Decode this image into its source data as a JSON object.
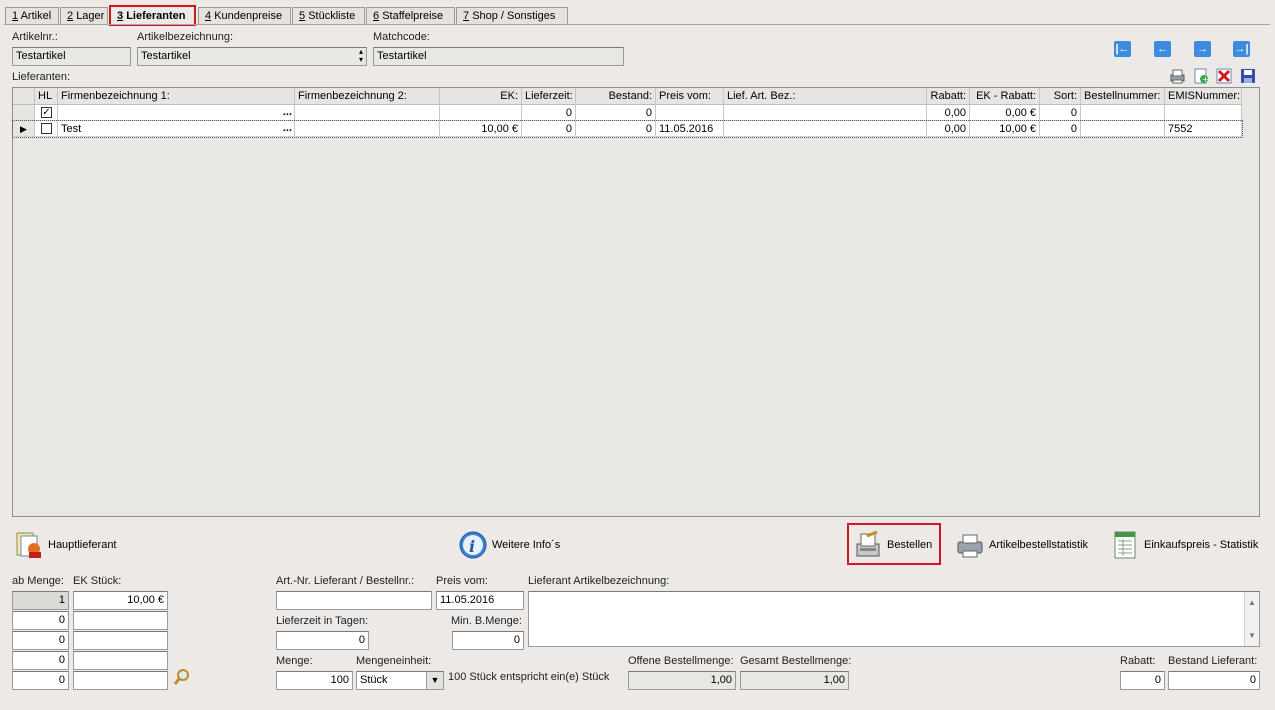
{
  "tabs": [
    {
      "num": "1",
      "label": "Artikel"
    },
    {
      "num": "2",
      "label": "Lager"
    },
    {
      "num": "3",
      "label": "Lieferanten"
    },
    {
      "num": "4",
      "label": "Kundenpreise"
    },
    {
      "num": "5",
      "label": "Stückliste"
    },
    {
      "num": "6",
      "label": "Staffelpreise"
    },
    {
      "num": "7",
      "label": "Shop / Sonstiges"
    }
  ],
  "header": {
    "artikelnr_label": "Artikelnr.:",
    "artikelnr_value": "Testartikel",
    "artikelbez_label": "Artikelbezeichnung:",
    "artikelbez_value": "Testartikel",
    "matchcode_label": "Matchcode:",
    "matchcode_value": "Testartikel",
    "lieferanten_label": "Lieferanten:"
  },
  "grid": {
    "columns": [
      "HL",
      "Firmenbezeichnung 1:",
      "Firmenbezeichnung 2:",
      "EK:",
      "Lieferzeit:",
      "Bestand:",
      "Preis vom:",
      "Lief. Art. Bez.:",
      "Rabatt:",
      "EK - Rabatt:",
      "Sort:",
      "Bestellnummer:",
      "EMISNummer:"
    ],
    "rows": [
      {
        "hl": "✓",
        "firma1": "",
        "firma2": "",
        "ek": "",
        "lieferzeit": "0",
        "bestand": "0",
        "preis_vom": "",
        "lief_art_bez": "",
        "rabatt": "0,00",
        "ek_rabatt": "0,00 €",
        "sort": "0",
        "bestellnummer": "",
        "emis": ""
      },
      {
        "hl": "",
        "firma1": "Test",
        "firma2": "",
        "ek": "10,00 €",
        "lieferzeit": "0",
        "bestand": "0",
        "preis_vom": "11.05.2016",
        "lief_art_bez": "",
        "rabatt": "0,00",
        "ek_rabatt": "10,00 €",
        "sort": "0",
        "bestellnummer": "",
        "emis": "7552"
      }
    ]
  },
  "toolbar": {
    "hauptlieferant": "Hauptlieferant",
    "weitere_infos": "Weitere Info´s",
    "bestellen": "Bestellen",
    "artikelbestellstatistik": "Artikelbestellstatistik",
    "einkaufspreis_statistik": "Einkaufspreis - Statistik"
  },
  "bottom": {
    "ab_menge_label": "ab Menge:",
    "ek_stueck_label": "EK Stück:",
    "staffel": [
      {
        "menge": "1",
        "ek": "10,00 €"
      },
      {
        "menge": "0",
        "ek": ""
      },
      {
        "menge": "0",
        "ek": ""
      },
      {
        "menge": "0",
        "ek": ""
      },
      {
        "menge": "0",
        "ek": ""
      }
    ],
    "artnr_label": "Art.-Nr. Lieferant / Bestellnr.:",
    "artnr_value": "",
    "preis_vom_label": "Preis vom:",
    "preis_vom_value": "11.05.2016",
    "lief_artbez_label": "Lieferant Artikelbezeichnung:",
    "lief_artbez_value": "",
    "lieferzeit_label": "Lieferzeit in Tagen:",
    "lieferzeit_value": "0",
    "min_bmenge_label": "Min. B.Menge:",
    "min_bmenge_value": "0",
    "menge_label": "Menge:",
    "menge_value": "100",
    "mengeneinheit_label": "Mengeneinheit:",
    "mengeneinheit_value": "Stück",
    "menge_hint": "100 Stück entspricht ein(e) Stück",
    "offene_label": "Offene Bestellmenge:",
    "offene_value": "1,00",
    "gesamt_label": "Gesamt Bestellmenge:",
    "gesamt_value": "1,00",
    "rabatt_label": "Rabatt:",
    "rabatt_value": "0",
    "bestand_lief_label": "Bestand Lieferant:",
    "bestand_lief_value": "0"
  },
  "colors": {
    "accent_red": "#d01818",
    "nav_blue": "#3d8ce0"
  }
}
